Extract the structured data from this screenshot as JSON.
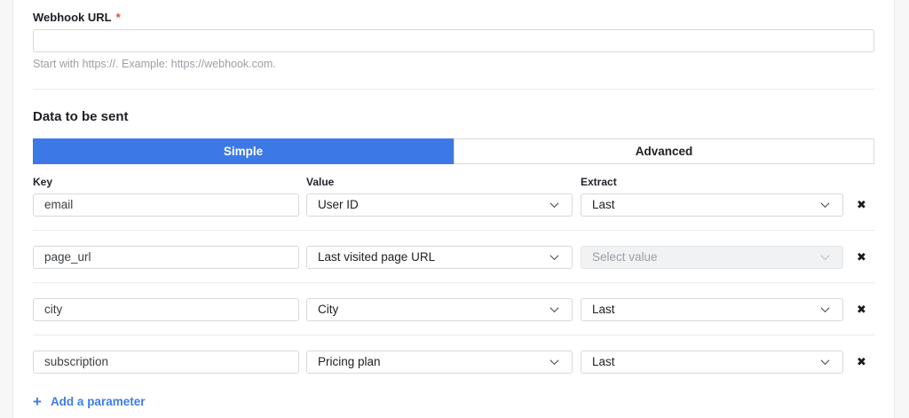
{
  "webhook": {
    "label": "Webhook URL",
    "required_mark": "*",
    "value": "",
    "helper": "Start with https://. Example: https://webhook.com."
  },
  "data_section": {
    "title": "Data to be sent",
    "tabs": [
      {
        "label": "Simple",
        "active": true
      },
      {
        "label": "Advanced",
        "active": false
      }
    ]
  },
  "params": {
    "columns": [
      "Key",
      "Value",
      "Extract"
    ],
    "rows": [
      {
        "key": "email",
        "value": "User ID",
        "extract": "Last",
        "extract_disabled": false
      },
      {
        "key": "page_url",
        "value": "Last visited page URL",
        "extract": "Select value",
        "extract_disabled": true
      },
      {
        "key": "city",
        "value": "City",
        "extract": "Last",
        "extract_disabled": false
      },
      {
        "key": "subscription",
        "value": "Pricing plan",
        "extract": "Last",
        "extract_disabled": false
      }
    ],
    "remove_icon": "✖",
    "add_icon": "+",
    "add_label": "Add a parameter"
  },
  "colors": {
    "accent_blue": "#3c79e6",
    "link_blue": "#3d7de9",
    "required_red": "#e5493d"
  }
}
